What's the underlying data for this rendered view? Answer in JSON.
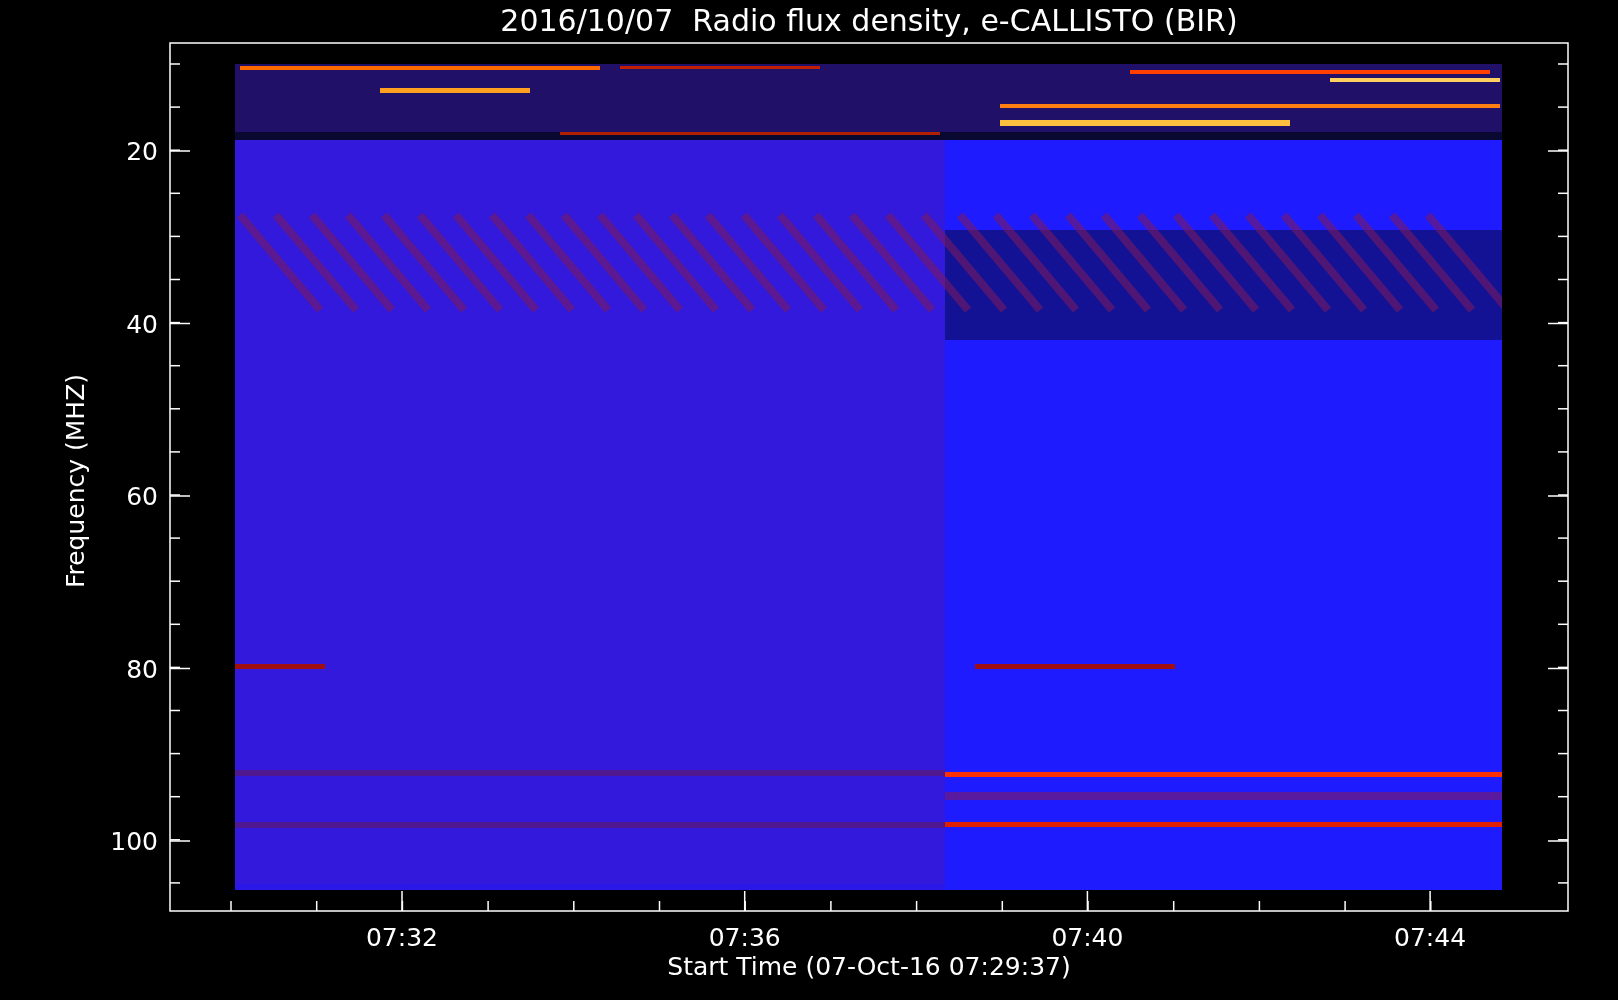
{
  "title": "2016/10/07  Radio flux density, e-CALLISTO (BIR)",
  "ylabel": "Frequency (MHZ)",
  "xlabel": "Start Time (07-Oct-16 07:29:37)",
  "yticks": [
    "20",
    "40",
    "60",
    "80",
    "100"
  ],
  "xticks": [
    "07:32",
    "07:36",
    "07:40",
    "07:44"
  ]
}
